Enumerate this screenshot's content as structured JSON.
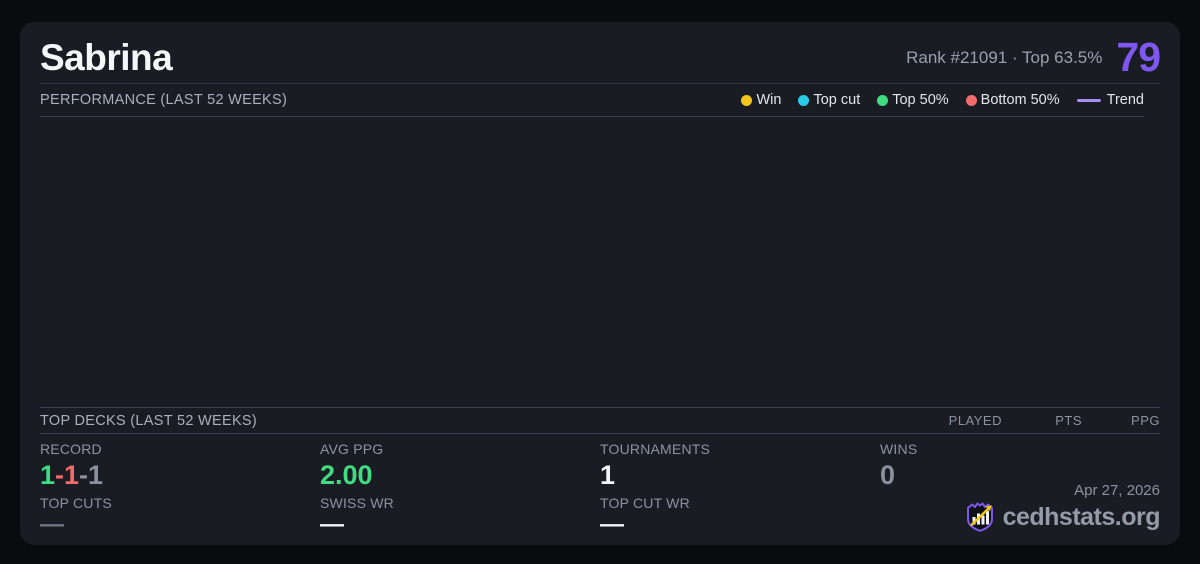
{
  "colors": {
    "page_bg": "#0a0b0e",
    "card_bg": "#1a1c24",
    "accent_purple": "#7d57ee",
    "trend_purple": "#a78bfa",
    "win_yellow": "#f2c61d",
    "topcut_cyan": "#2bc9e8",
    "green": "#3fdc81",
    "red": "#f16b6b",
    "gray_value": "#8a919e",
    "white_value": "#f2f4f7",
    "muted_dash": "#6f7583"
  },
  "header": {
    "title": "Sabrina",
    "rank_text": "Rank #21091  ·  Top 63.5%",
    "score": "79"
  },
  "performance": {
    "heading": "PERFORMANCE (LAST 52 WEEKS)",
    "legend": [
      {
        "label": "Win",
        "color": "#f2c61d"
      },
      {
        "label": "Top cut",
        "color": "#2bc9e8"
      },
      {
        "label": "Top 50%",
        "color": "#3fdc81"
      },
      {
        "label": "Bottom 50%",
        "color": "#f16b6b"
      },
      {
        "label": "Trend",
        "color": "#a78bfa"
      }
    ]
  },
  "chart_data": {
    "type": "scatter",
    "title": "PERFORMANCE (LAST 52 WEEKS)",
    "series": [],
    "legend_entries": [
      "Win",
      "Top cut",
      "Top 50%",
      "Bottom 50%",
      "Trend"
    ],
    "legend_position": "top-right",
    "grid": false,
    "note": "chart plot area is empty - no data points, axes or gridlines rendered"
  },
  "top_decks": {
    "heading": "TOP DECKS (LAST 52 WEEKS)",
    "columns": [
      "PLAYED",
      "PTS",
      "PPG"
    ],
    "rows": []
  },
  "stats": {
    "record": {
      "label": "RECORD",
      "parts": [
        {
          "text": "1",
          "color": "#3fdc81"
        },
        {
          "text": "-1",
          "color": "#f16b6b"
        },
        {
          "text": "-1",
          "color": "#8a919e"
        }
      ]
    },
    "avg_ppg": {
      "label": "AVG PPG",
      "value": "2.00",
      "color": "#3fdc81"
    },
    "tournaments": {
      "label": "TOURNAMENTS",
      "value": "1",
      "color": "#f2f4f7"
    },
    "wins": {
      "label": "WINS",
      "value": "0",
      "color": "#8a919e"
    },
    "top_cuts": {
      "label": "TOP CUTS",
      "value": "—",
      "color": "#6f7583"
    },
    "swiss_wr": {
      "label": "SWISS WR",
      "value": "—",
      "color": "#f2f4f7"
    },
    "top_cut_wr": {
      "label": "TOP CUT WR",
      "value": "—",
      "color": "#f2f4f7"
    }
  },
  "footer": {
    "date": "Apr 27, 2026",
    "brand": "cedhstats.org",
    "logo": "shield-chart-arrow-logo"
  }
}
